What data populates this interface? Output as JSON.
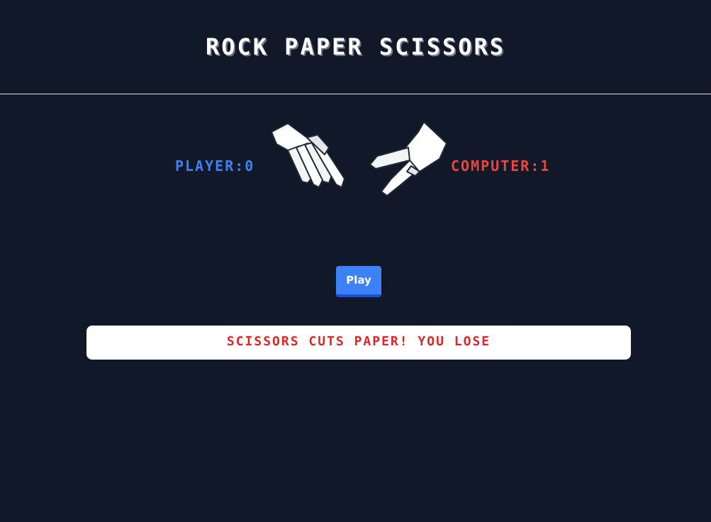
{
  "header": {
    "title": "ROCK PAPER SCISSORS"
  },
  "scoreboard": {
    "player_label": "PLAYER:0",
    "computer_label": "COMPUTER:1",
    "player_score": 0,
    "computer_score": 1
  },
  "hands": {
    "player_choice": "paper",
    "player_icon": "paper-hand-icon",
    "computer_choice": "scissors",
    "computer_icon": "scissors-hand-icon"
  },
  "controls": {
    "play_label": "Play"
  },
  "result": {
    "message": "SCISSORS CUTS PAPER! YOU LOSE"
  },
  "colors": {
    "background": "#111827",
    "player": "#3b82f6",
    "computer": "#ef4444",
    "result_text": "#dc2626",
    "button": "#3b82f6"
  }
}
